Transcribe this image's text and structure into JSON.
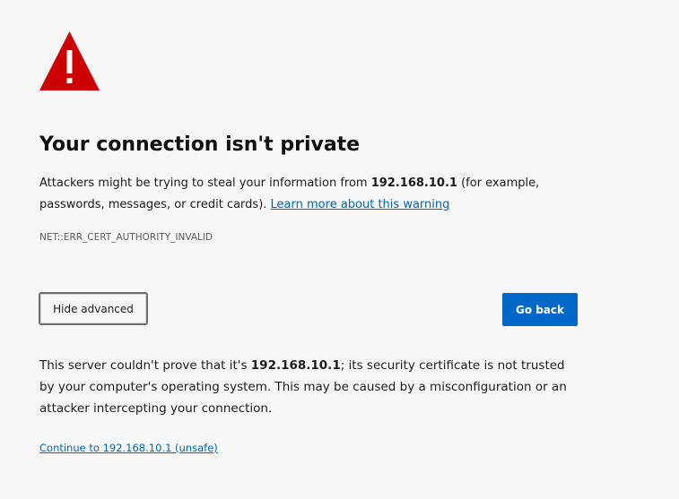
{
  "icon": {
    "name": "warning-icon",
    "color": "#cc0000"
  },
  "heading": "Your connection isn't private",
  "description": {
    "part1": "Attackers might be trying to steal your information from ",
    "host": "192.168.10.1",
    "part2": " (for example, passwords, messages, or credit cards). ",
    "learn_more": "Learn more about this warning"
  },
  "error_code": "NET::ERR_CERT_AUTHORITY_INVALID",
  "buttons": {
    "hide_advanced": "Hide advanced",
    "go_back": "Go back"
  },
  "details": {
    "part1": "This server couldn't prove that it's ",
    "host": "192.168.10.1",
    "part2": "; its security certificate is not trusted by your computer's operating system. This may be caused by a misconfiguration or an attacker intercepting your connection."
  },
  "proceed_link": "Continue to 192.168.10.1 (unsafe)",
  "colors": {
    "background": "#f7f7f7",
    "link": "#0064b0",
    "primary_button": "#0068c9",
    "warning": "#cc0000"
  }
}
